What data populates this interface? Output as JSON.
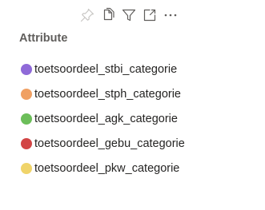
{
  "toolbar": {
    "icons": [
      "pin-icon",
      "copy-icon",
      "filter-icon",
      "focus-mode-icon",
      "more-options-icon"
    ],
    "icon_color": "#605e5c",
    "pin_color": "#c8c6c4"
  },
  "legend": {
    "title": "Attribute",
    "items": [
      {
        "label": "toetsoordeel_stbi_categorie",
        "color": "#8f6ad8"
      },
      {
        "label": "toetsoordeel_stph_categorie",
        "color": "#f0a063"
      },
      {
        "label": "toetsoordeel_agk_categorie",
        "color": "#6cbe5a"
      },
      {
        "label": "toetsoordeel_gebu_categorie",
        "color": "#d24545"
      },
      {
        "label": "toetsoordeel_pkw_categorie",
        "color": "#f0d46a"
      }
    ]
  }
}
